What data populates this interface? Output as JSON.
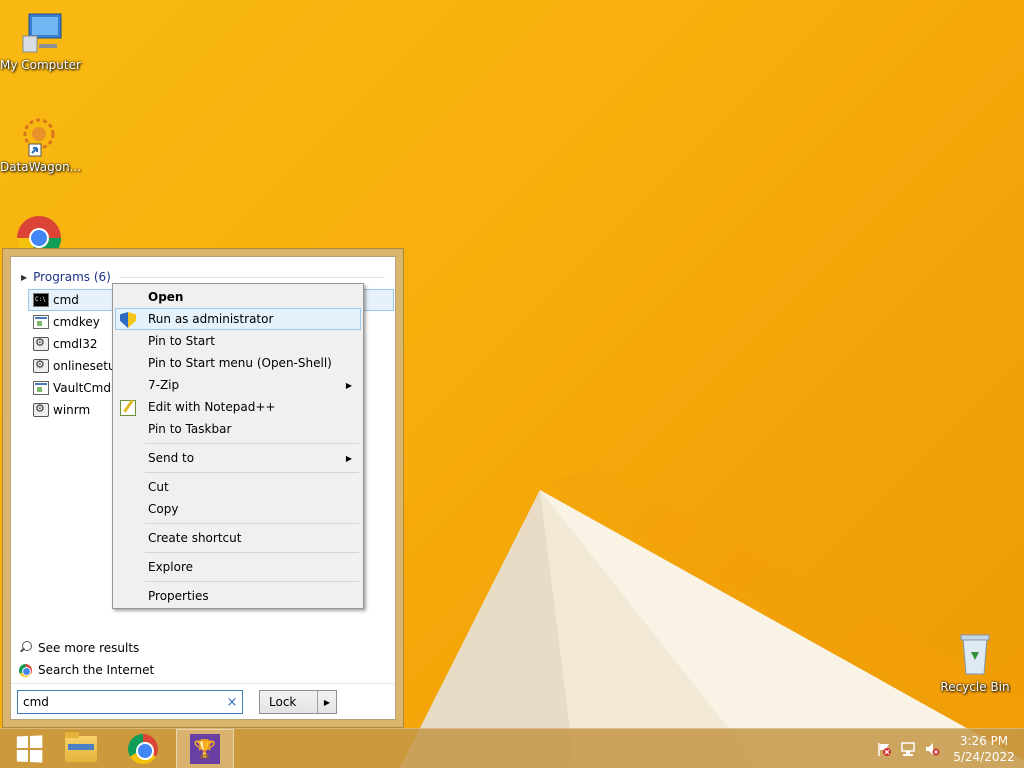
{
  "desktop": {
    "icons": [
      {
        "label": "My Computer",
        "icon": "computer-icon"
      },
      {
        "label": "DataWagon...",
        "icon": "datawagon-icon"
      },
      {
        "label": "",
        "icon": "chrome-icon"
      },
      {
        "label": "Recycle Bin",
        "icon": "recycle-bin-icon"
      }
    ]
  },
  "start_menu": {
    "programs_header": "Programs (6)",
    "programs": [
      {
        "label": "cmd",
        "icon": "cmd-icon"
      },
      {
        "label": "cmdkey",
        "icon": "window-icon"
      },
      {
        "label": "cmdl32",
        "icon": "gear-icon"
      },
      {
        "label": "onlinesetup",
        "icon": "gear-icon"
      },
      {
        "label": "VaultCmd",
        "icon": "window-icon"
      },
      {
        "label": "winrm",
        "icon": "gear-icon"
      }
    ],
    "see_more": "See more results",
    "search_internet": "Search the Internet",
    "search_value": "cmd",
    "clear_glyph": "×",
    "lock_label": "Lock",
    "lock_arrow": "▶"
  },
  "context_menu": {
    "items": [
      {
        "label": "Open",
        "bold": true
      },
      {
        "label": "Run as administrator",
        "icon": "shield-icon",
        "highlight": true
      },
      {
        "label": "Pin to Start"
      },
      {
        "label": "Pin to Start menu (Open-Shell)"
      },
      {
        "label": "7-Zip",
        "submenu": true
      },
      {
        "label": "Edit with Notepad++",
        "icon": "notepad-icon"
      },
      {
        "label": "Pin to Taskbar"
      },
      {
        "label": "Send to",
        "submenu": true
      },
      {
        "label": "Cut"
      },
      {
        "label": "Copy"
      },
      {
        "label": "Create shortcut"
      },
      {
        "label": "Explore"
      },
      {
        "label": "Properties"
      }
    ],
    "submenu_glyph": "▶"
  },
  "taskbar": {
    "time": "3:26 PM",
    "date": "5/24/2022",
    "trophy_glyph": "🏆"
  }
}
